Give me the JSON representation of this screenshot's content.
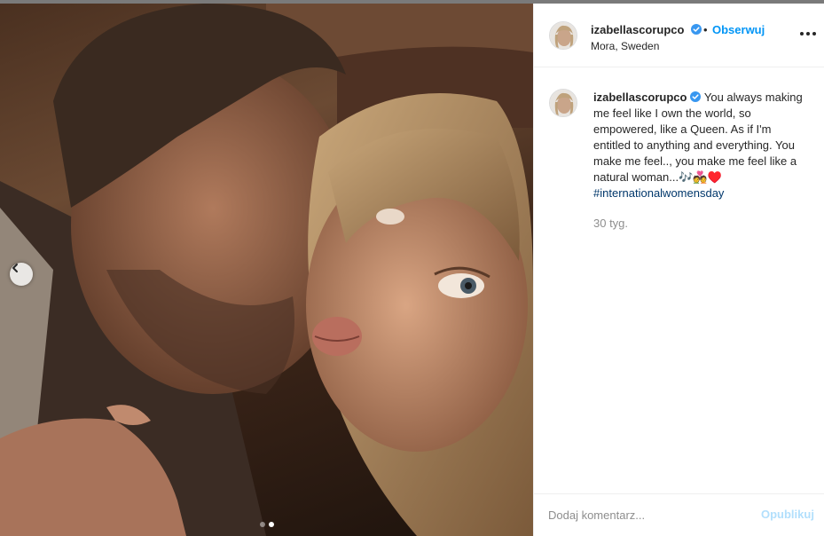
{
  "post": {
    "author": "izabellascorupco",
    "follow_label": "Obserwuj",
    "separator": "•",
    "location": "Mora, Sweden",
    "caption_text": "You always making me feel like I own the world, so empowered, like a Queen. As if I'm entitled to anything and everything. You make me feel.., you make me feel like a natural woman...🎶💑♥️",
    "hashtag": "#internationalwomensday",
    "timestamp": "30 tyg."
  },
  "carousel": {
    "total": 2,
    "active_index": 2
  },
  "comment": {
    "placeholder": "Dodaj komentarz...",
    "publish_label": "Opublikuj"
  },
  "colors": {
    "accent": "#0095f6",
    "publish_disabled": "#b2dffc",
    "hashtag": "#00376b",
    "muted": "#8e8e8e"
  },
  "icons": {
    "verified": "verified-badge-icon",
    "more": "more-options-icon",
    "prev": "chevron-left-icon"
  }
}
